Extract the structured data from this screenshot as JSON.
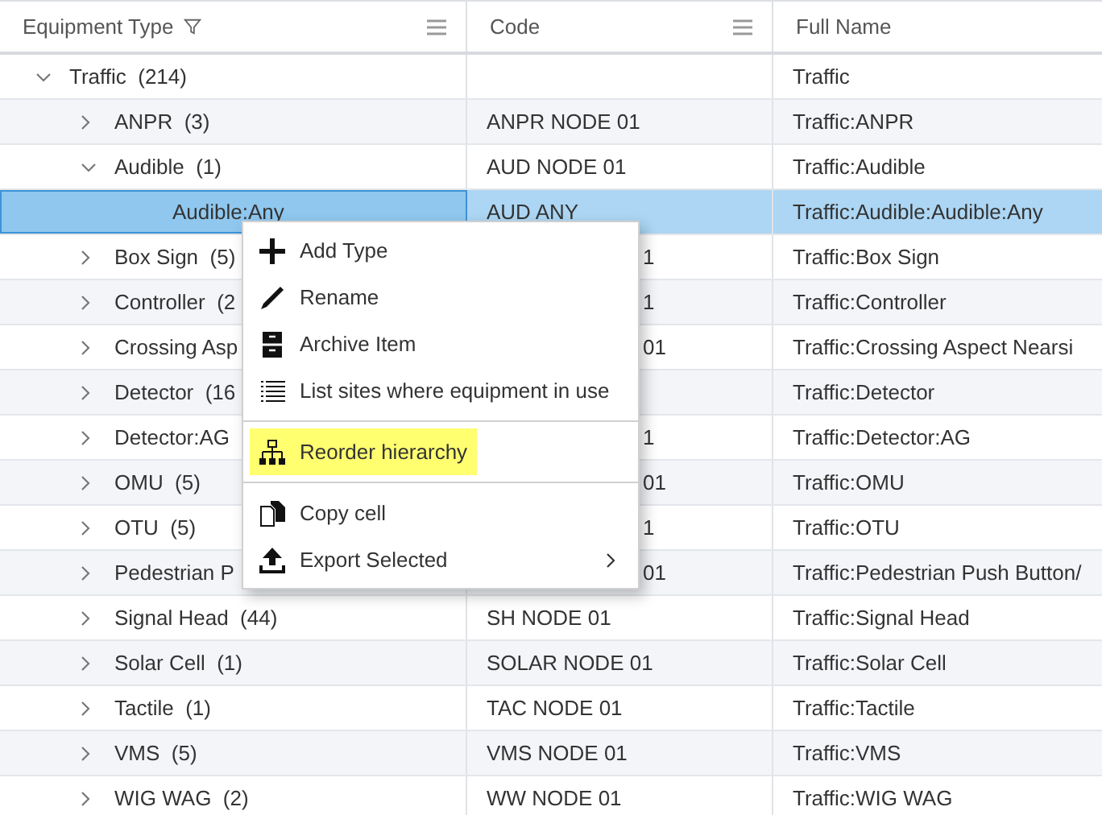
{
  "columns": [
    {
      "title": "Equipment Type",
      "filter": true,
      "menu": true
    },
    {
      "title": "Code",
      "filter": false,
      "menu": true
    },
    {
      "title": "Full Name",
      "filter": false,
      "menu": false
    }
  ],
  "rows": [
    {
      "label": "Traffic  (214)",
      "expanded": true,
      "selected": false,
      "full_name": "Traffic",
      "children": [
        {
          "label": "ANPR  (3)",
          "expanded": false,
          "selected": false,
          "code": "ANPR NODE 01",
          "full_name": "Traffic:ANPR"
        },
        {
          "label": "Audible  (1)",
          "expanded": true,
          "selected": false,
          "code": "AUD NODE 01",
          "full_name": "Traffic:Audible",
          "children": [
            {
              "label": "Audible:Any",
              "selected": true,
              "code": "AUD ANY",
              "full_name": "Traffic:Audible:Audible:Any"
            }
          ]
        },
        {
          "label": "Box Sign  (5)",
          "expanded": false,
          "selected": false,
          "code": "1",
          "code_under_menu": true,
          "full_name": "Traffic:Box Sign"
        },
        {
          "label": "Controller  (2",
          "expanded": false,
          "selected": false,
          "code": "1",
          "code_under_menu": true,
          "full_name": "Traffic:Controller"
        },
        {
          "label": "Crossing Asp",
          "expanded": false,
          "selected": false,
          "code": "01",
          "code_under_menu": true,
          "full_name": "Traffic:Crossing Aspect Nearsi"
        },
        {
          "label": "Detector  (16",
          "expanded": false,
          "selected": false,
          "full_name": "Traffic:Detector"
        },
        {
          "label": "Detector:AG",
          "expanded": false,
          "selected": false,
          "code": "1",
          "code_under_menu": true,
          "full_name": "Traffic:Detector:AG"
        },
        {
          "label": "OMU  (5)",
          "expanded": false,
          "selected": false,
          "code": "01",
          "code_under_menu": true,
          "full_name": "Traffic:OMU"
        },
        {
          "label": "OTU  (5)",
          "expanded": false,
          "selected": false,
          "code": "1",
          "code_under_menu": true,
          "full_name": "Traffic:OTU"
        },
        {
          "label": "Pedestrian P",
          "expanded": false,
          "selected": false,
          "code": "01",
          "code_under_menu": true,
          "full_name": "Traffic:Pedestrian Push Button/"
        },
        {
          "label": "Signal Head  (44)",
          "expanded": false,
          "selected": false,
          "code": "SH NODE 01",
          "full_name": "Traffic:Signal Head"
        },
        {
          "label": "Solar Cell  (1)",
          "expanded": false,
          "selected": false,
          "code": "SOLAR NODE 01",
          "full_name": "Traffic:Solar Cell"
        },
        {
          "label": "Tactile  (1)",
          "expanded": false,
          "selected": false,
          "code": "TAC NODE 01",
          "full_name": "Traffic:Tactile"
        },
        {
          "label": "VMS  (5)",
          "expanded": false,
          "selected": false,
          "code": "VMS NODE 01",
          "full_name": "Traffic:VMS"
        },
        {
          "label": "WIG WAG  (2)",
          "expanded": false,
          "selected": false,
          "code": "WW NODE 01",
          "full_name": "Traffic:WIG WAG"
        }
      ]
    }
  ],
  "context_menu": [
    {
      "kind": "item",
      "label": "Add Type",
      "highlighted": false,
      "submenu": false
    },
    {
      "kind": "item",
      "label": "Rename",
      "highlighted": false,
      "submenu": false
    },
    {
      "kind": "item",
      "label": "Archive Item",
      "highlighted": false,
      "submenu": false
    },
    {
      "kind": "item",
      "label": "List sites where equipment in use",
      "highlighted": false,
      "submenu": false
    },
    {
      "kind": "separator"
    },
    {
      "kind": "item",
      "label": "Reorder hierarchy",
      "highlighted": true,
      "submenu": false
    },
    {
      "kind": "separator"
    },
    {
      "kind": "item",
      "label": "Copy cell",
      "highlighted": false,
      "submenu": false
    },
    {
      "kind": "item",
      "label": "Export Selected",
      "highlighted": false,
      "submenu": true
    }
  ]
}
